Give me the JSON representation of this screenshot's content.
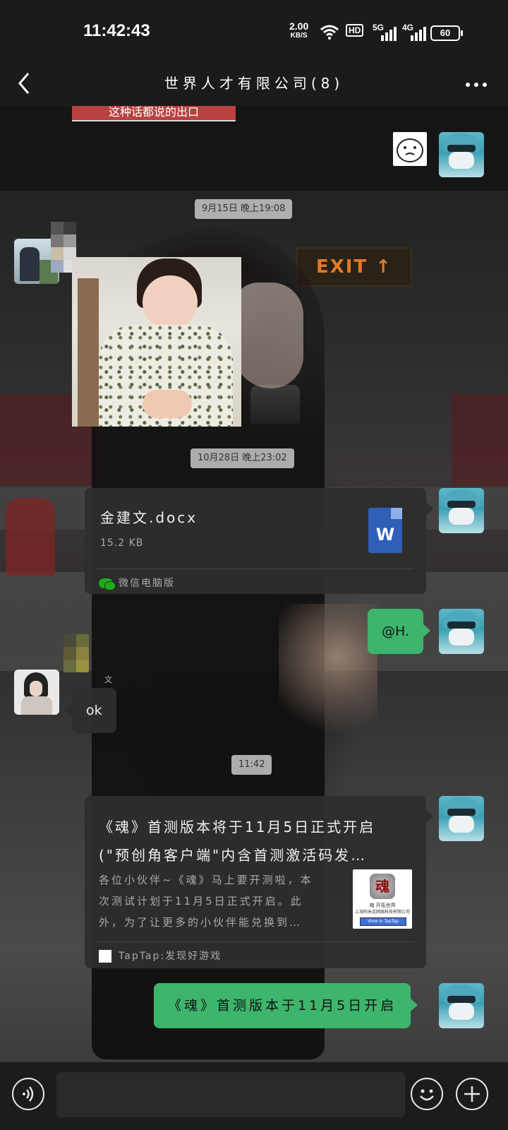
{
  "status_bar": {
    "time": "11:42:43",
    "net_speed_value": "2.00",
    "net_speed_unit": "KB/S",
    "hd_label": "HD",
    "signal1_label": "5G",
    "signal2_label": "4G",
    "battery": "60"
  },
  "nav": {
    "title": "世界人才有限公司(8)",
    "more_icon": "more-dots-icon",
    "back_icon": "back-chevron-icon"
  },
  "top_strip_text": "这种话都说的出口",
  "timestamps": {
    "t1": "9月15日 晚上19:08",
    "t2": "10月28日 晚上23:02",
    "t3": "11:42"
  },
  "file_card": {
    "name": "金建文.docx",
    "size": "15.2 KB",
    "icon_label": "W",
    "footer": "微信电脑版"
  },
  "messages": {
    "mention": "@H.",
    "ok_sender": "文",
    "ok": "ok",
    "last": "《魂》首测版本于11月5日开启"
  },
  "link_card": {
    "title_line1": "《魂》首测版本将于11月5日正式开启",
    "title_line2": "(\"预创角客户端\"内含首测激活码发…",
    "desc_line1": "各位小伙伴~《魂》马上要开测啦，本",
    "desc_line2": "次测试计划于11月5日正式开启。此",
    "desc_line3": "外，为了让更多的小伙伴能兑换到…",
    "thumb_logo": "魂",
    "thumb_line1": "魂 开拓世界",
    "thumb_line2": "上海阿米克网络科技有限公司",
    "thumb_button": "View in TapTap",
    "footer": "TapTap:发现好游戏"
  },
  "background": {
    "exit_sign": "EXIT ↑"
  },
  "colors": {
    "accent_green": "#3eb56c",
    "bubble_dark": "#2e2e2e",
    "bar": "#1b1b1b"
  }
}
